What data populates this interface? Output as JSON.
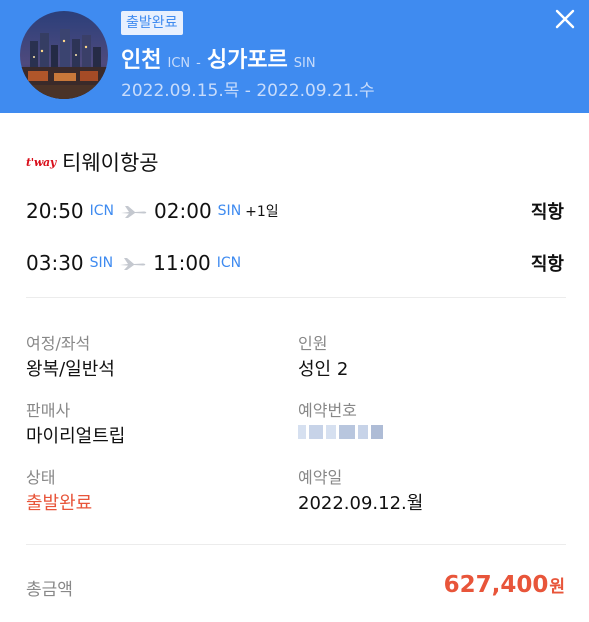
{
  "header": {
    "status_badge": "출발완료",
    "origin_city": "인천",
    "origin_code": "ICN",
    "separator": "-",
    "dest_city": "싱가포르",
    "dest_code": "SIN",
    "dates": "2022.09.15.목 - 2022.09.21.수",
    "close_icon": "close-icon"
  },
  "airline": {
    "logo_text": "t'way",
    "name": "티웨이항공"
  },
  "segments": [
    {
      "dep_time": "20:50",
      "dep_code": "ICN",
      "arr_time": "02:00",
      "arr_code": "SIN",
      "day_offset": "+1일",
      "type": "직항"
    },
    {
      "dep_time": "03:30",
      "dep_code": "SIN",
      "arr_time": "11:00",
      "arr_code": "ICN",
      "day_offset": "",
      "type": "직항"
    }
  ],
  "details": {
    "itinerary_label": "여정/좌석",
    "itinerary_value": "왕복/일반석",
    "passengers_label": "인원",
    "passengers_value": "성인 2",
    "seller_label": "판매사",
    "seller_value": "마이리얼트립",
    "booking_no_label": "예약번호",
    "status_label": "상태",
    "status_value": "출발완료",
    "booking_date_label": "예약일",
    "booking_date_value": "2022.09.12.월"
  },
  "total": {
    "label": "총금액",
    "amount": "627,400",
    "unit": "원"
  },
  "colors": {
    "header_bg": "#3f8bf0",
    "accent_red": "#e8553a",
    "airline_red": "#d90e1a"
  }
}
